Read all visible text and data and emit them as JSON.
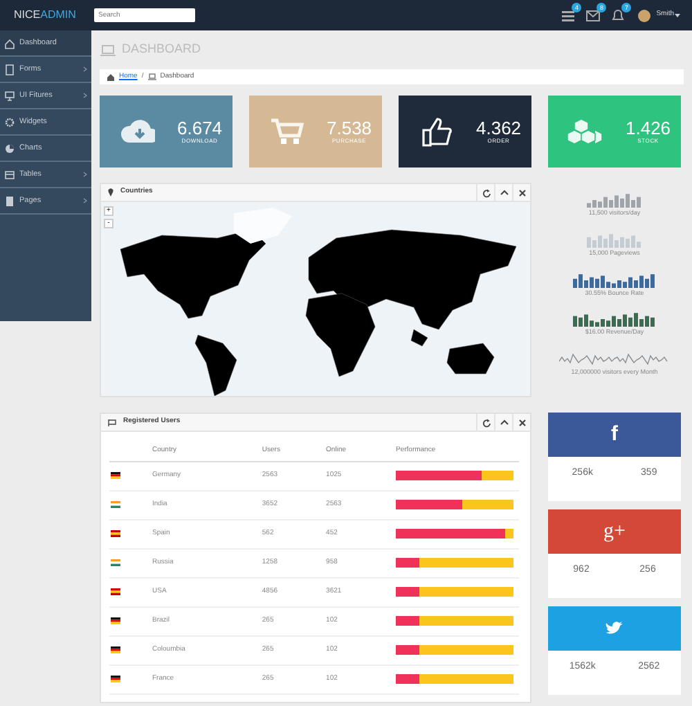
{
  "navbar": {
    "logo_first": "NICE",
    "logo_second": "ADMIN",
    "search": {
      "placeholder": "Search"
    },
    "notifications": [
      {
        "kind": "tasks",
        "count": "4"
      },
      {
        "kind": "mail",
        "count": "8"
      },
      {
        "kind": "bell",
        "count": "7"
      }
    ],
    "user": "Smith"
  },
  "sidebar": {
    "items": [
      {
        "kind": "home",
        "label": "Dashboard",
        "selected": true,
        "expandable": false
      },
      {
        "kind": "form",
        "label": "Forms",
        "selected": false,
        "expandable": true
      },
      {
        "kind": "monitor",
        "label": "UI Fitures",
        "selected": false,
        "expandable": true
      },
      {
        "kind": "gear",
        "label": "Widgets",
        "selected": false,
        "expandable": false
      },
      {
        "kind": "pie",
        "label": "Charts",
        "selected": false,
        "expandable": false
      },
      {
        "kind": "table",
        "label": "Tables",
        "selected": false,
        "expandable": true
      },
      {
        "kind": "page",
        "label": "Pages",
        "selected": false,
        "expandable": true
      }
    ]
  },
  "page_title": "DASHBOARD",
  "breadcrumb": [
    "Home",
    "Dashboard"
  ],
  "breadcrumb_separator": "/",
  "stats": [
    {
      "kind": "download",
      "value": "6.674",
      "label": "DOWNLOAD",
      "color": "#5b8aa3"
    },
    {
      "kind": "cart",
      "value": "7.538",
      "label": "PURCHASE",
      "color": "#d5b994"
    },
    {
      "kind": "like",
      "value": "4.362",
      "label": "ORDER",
      "color": "#1f2b3a"
    },
    {
      "kind": "cubes",
      "value": "1.426",
      "label": "STOCK",
      "color": "#2ec37f"
    }
  ],
  "countries_panel": {
    "title": "Countries",
    "zoom_controls": [
      "+",
      "-"
    ]
  },
  "sparklines": [
    {
      "kind": "bars",
      "caption": "11,500 visitors/day",
      "color": "#9ea4aa"
    },
    {
      "kind": "bars",
      "caption": "15,000 Pageviews",
      "color": "#c5ccd4"
    },
    {
      "kind": "bars",
      "caption": "30.55% Bounce Rate",
      "color": "#3c6a9c"
    },
    {
      "kind": "bars",
      "caption": "$16.00 Revenue/Day",
      "color": "#3f6b53"
    },
    {
      "kind": "line",
      "caption": "12,000000 visitors every Month",
      "color": "#8a8f94"
    }
  ],
  "users_panel": {
    "title": "Registered Users",
    "columns": [
      "Country",
      "Users",
      "Online",
      "Performance"
    ],
    "rows": [
      {
        "kind": "germany",
        "country": "Germany",
        "users": "2563",
        "online": "1025",
        "level": 0.73
      },
      {
        "kind": "india",
        "country": "India",
        "users": "3652",
        "online": "2563",
        "level": 0.57
      },
      {
        "kind": "spain",
        "country": "Spain",
        "users": "562",
        "online": "452",
        "level": 0.93
      },
      {
        "kind": "india",
        "country": "Russia",
        "users": "1258",
        "online": "958",
        "level": 0.2
      },
      {
        "kind": "spain",
        "country": "USA",
        "users": "4856",
        "online": "3621",
        "level": 0.2
      },
      {
        "kind": "germany",
        "country": "Brazil",
        "users": "265",
        "online": "102",
        "level": 0.2
      },
      {
        "kind": "germany",
        "country": "Coloumbia",
        "users": "265",
        "online": "102",
        "level": 0.2
      },
      {
        "kind": "germany",
        "country": "France",
        "users": "265",
        "online": "102",
        "level": 0.2
      }
    ]
  },
  "social": [
    {
      "kind": "facebook",
      "glyph": "f",
      "counts": [
        "256k",
        "359"
      ]
    },
    {
      "kind": "google",
      "glyph": "g+",
      "counts": [
        "962",
        "256"
      ]
    },
    {
      "kind": "twitter",
      "counts": [
        "1562k",
        "2562"
      ]
    }
  ]
}
